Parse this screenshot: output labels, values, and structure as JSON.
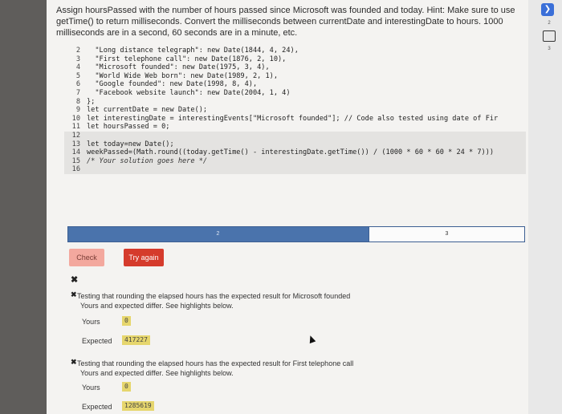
{
  "prompt": "Assign hoursPassed with the number of hours passed since Microsoft was founded and today. Hint: Make sure to use getTime() to return milliseconds. Convert the milliseconds between currentDate and interestingDate to hours. 1000 milliseconds are in a second, 60 seconds are in a minute, etc.",
  "code_lines": [
    {
      "n": "2",
      "text": "  \"Long distance telegraph\": new Date(1844, 4, 24),"
    },
    {
      "n": "3",
      "text": "  \"First telephone call\": new Date(1876, 2, 10),"
    },
    {
      "n": "4",
      "text": "  \"Microsoft founded\": new Date(1975, 3, 4),"
    },
    {
      "n": "5",
      "text": "  \"World Wide Web born\": new Date(1989, 2, 1),"
    },
    {
      "n": "6",
      "text": "  \"Google founded\": new Date(1998, 8, 4),"
    },
    {
      "n": "7",
      "text": "  \"Facebook website launch\": new Date(2004, 1, 4)"
    },
    {
      "n": "8",
      "text": "};"
    },
    {
      "n": "9",
      "text": "let currentDate = new Date();"
    },
    {
      "n": "10",
      "text": "let interestingDate = interestingEvents[\"Microsoft founded\"]; // Code also tested using date of Fir"
    },
    {
      "n": "11",
      "text": "let hoursPassed = 0;"
    },
    {
      "n": "12",
      "text": ""
    },
    {
      "n": "13",
      "text": "let today=new Date();"
    },
    {
      "n": "14",
      "text": "weekPassed=(Math.round((today.getTime() - interestingDate.getTime()) / (1000 * 60 * 60 * 24 * 7)))"
    },
    {
      "n": "15",
      "text": "/* Your solution goes here */"
    },
    {
      "n": "16",
      "text": ""
    }
  ],
  "progress": {
    "step2": "2",
    "step3": "3"
  },
  "buttons": {
    "check": "Check",
    "try_again": "Try again"
  },
  "results": [
    {
      "title": "Testing that rounding the elapsed hours has the expected result for Microsoft founded",
      "sub": "Yours and expected differ. See highlights below.",
      "yours_label": "Yours",
      "yours_value": "0",
      "expected_label": "Expected",
      "expected_value": "417227"
    },
    {
      "title": "Testing that rounding the elapsed hours has the expected result for First telephone call",
      "sub": "Yours and expected differ. See highlights below.",
      "yours_label": "Yours",
      "yours_value": "0",
      "expected_label": "Expected",
      "expected_value": "1285619"
    }
  ],
  "side": {
    "n1": "2",
    "n2": "3"
  }
}
